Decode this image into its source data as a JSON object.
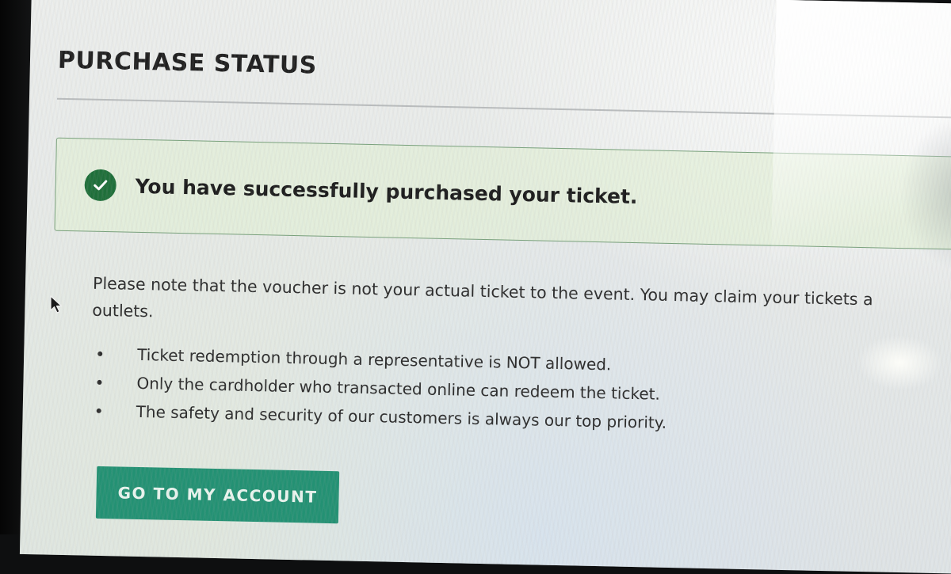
{
  "page": {
    "title": "PURCHASE STATUS"
  },
  "alert": {
    "icon": "check-circle-icon",
    "message": "You have successfully purchased your ticket.",
    "colors": {
      "border": "#77a07a",
      "background": "#e2f0d5",
      "icon": "#1f6f3a"
    }
  },
  "note": {
    "line1": "Please note that the voucher is not your actual ticket to the event. You may claim your tickets a",
    "line2": "outlets."
  },
  "rules": [
    "Ticket redemption through a representative is NOT allowed.",
    "Only the cardholder who transacted online can redeem the ticket.",
    "The safety and security of our customers is always our top priority."
  ],
  "actions": {
    "account_button_label": "GO TO MY ACCOUNT",
    "button_color": "#239173"
  },
  "cursor": {
    "icon": "mouse-pointer-icon"
  }
}
